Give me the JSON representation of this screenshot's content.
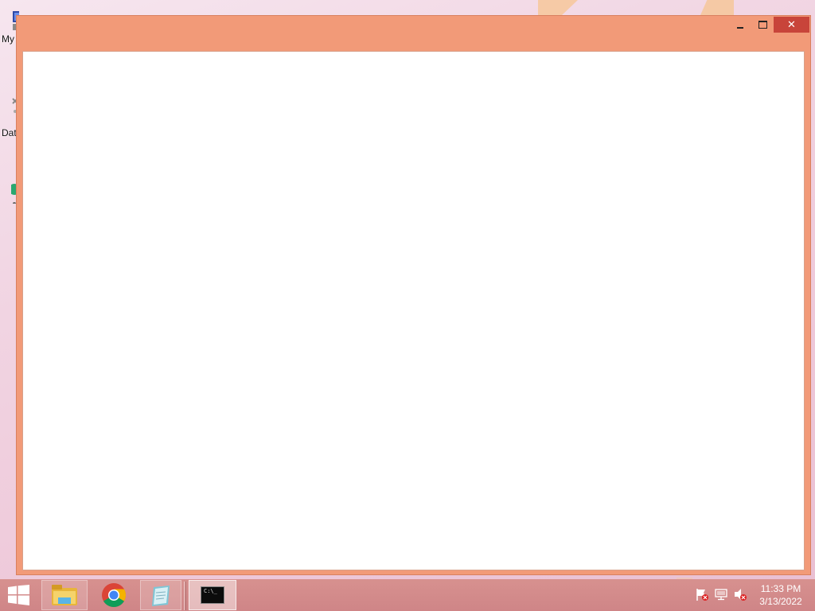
{
  "desktop": {
    "icons": [
      {
        "label": "My",
        "icon": "computer-icon"
      },
      {
        "label": "Dat",
        "icon": "data-icon"
      },
      {
        "label": "",
        "icon": "app-icon"
      }
    ]
  },
  "window": {
    "title": "",
    "accent_color": "#f29a78",
    "close_color": "#c8443a",
    "caption_buttons": {
      "minimize": "minimize-icon",
      "maximize": "maximize-icon",
      "close": "✕"
    }
  },
  "taskbar": {
    "color": "#d38a8c",
    "start": "windows-logo-icon",
    "pinned": [
      {
        "name": "File Explorer",
        "icon": "folder-icon"
      },
      {
        "name": "Google Chrome",
        "icon": "chrome-icon"
      },
      {
        "name": "Notes",
        "icon": "notes-icon"
      },
      {
        "name": "Command Prompt",
        "icon": "cmd-icon",
        "glyph_text": "C:\\_",
        "active": true
      }
    ],
    "tray": {
      "icons": [
        "action-center-flag-icon",
        "network-icon",
        "volume-muted-icon"
      ],
      "time": "11:33 PM",
      "date": "3/13/2022"
    }
  }
}
